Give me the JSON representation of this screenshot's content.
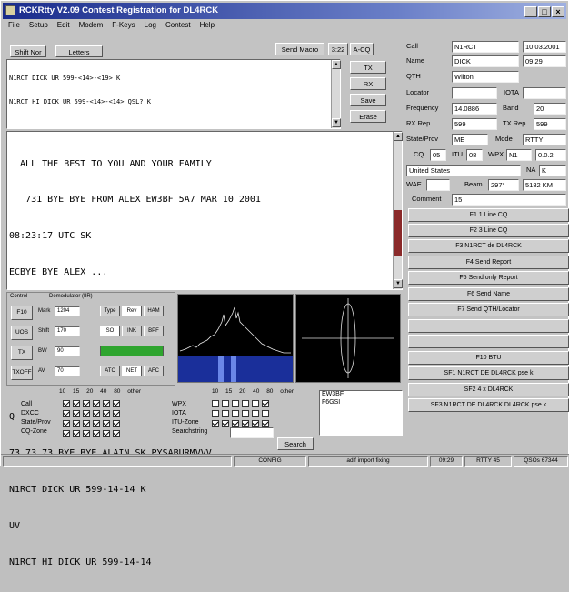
{
  "window": {
    "title": "RCKRtty V2.09 Contest Registration for DL4RCK"
  },
  "menu": [
    "File",
    "Setup",
    "Edit",
    "Modem",
    "F-Keys",
    "Log",
    "Contest",
    "Help"
  ],
  "toolbar": {
    "shift_nor": "Shift Nor",
    "letters": "Letters",
    "send_macro": "Send Macro",
    "time": "3:22",
    "acq": "A-CQ"
  },
  "side_buttons": {
    "tx": "TX",
    "rx": "RX",
    "save": "Save",
    "erase": "Erase"
  },
  "tx_text": [
    "N1RCT DICK UR 599-<14>-<19> K",
    "",
    "N1RCT HI DICK UR 599-<14>-<14> QSL? K"
  ],
  "rx_text": [
    "  ALL THE BEST TO YOU AND YOUR FAMILY",
    "   731 BYE BYE FROM ALEX EW3BF 5A7 MAR 10 2001",
    "08:23:17 UTC SK",
    "ECBYE BYE ALEX ...",
    "",
    "",
    "",
    "Q",
    "73 73 73 BYE BYE ALAIN SK PYSABURMVVV",
    "N1RCT DICK UR 599-14-14 K",
    "UV",
    "N1RCT HI DICK UR 599-14-14"
  ],
  "log": {
    "call_label": "Call",
    "call": "N1RCT",
    "date": "10.03.2001",
    "name_label": "Name",
    "name": "DICK",
    "time": "09:29",
    "qth_label": "QTH",
    "qth": "Wilton",
    "locator_label": "Locator",
    "iota_label": "IOTA",
    "freq_label": "Frequency",
    "freq": "14.0886",
    "band_label": "Band",
    "band": "20",
    "rxrep_label": "RX Rep",
    "rxrep": "599",
    "txrep_label": "TX Rep",
    "txrep": "599",
    "state_label": "State/Prov",
    "state": "ME",
    "mode_label": "Mode",
    "mode": "RTTY",
    "cq_label": "CQ",
    "cq": "05",
    "itu_label": "ITU",
    "itu": "08",
    "wpx_label": "WPX",
    "wpx": "N1",
    "wpx2": "0.0.2",
    "country": "United States",
    "na": "NA",
    "k": "K",
    "wae_label": "WAE",
    "beam_label": "Beam",
    "beam": "297°",
    "dist": "5182 KM",
    "comment_label": "Comment",
    "comment": "15"
  },
  "macros": [
    "F1 1 Line CQ",
    "F2 3 Line CQ",
    "F3 N1RCT de DL4RCK",
    "F4 Send Report",
    "F5 Send only Report",
    "F6 Send Name",
    "F7 Send QTH/Locator",
    "",
    "",
    "F10 BTU",
    "SF1 N1RCT DE DL4RCK pse k",
    "SF2 4 x DL4RCK",
    "SF3 N1RCT DE DL4RCK DL4RCK pse k"
  ],
  "control": {
    "control_label": "Control",
    "demod_label": "Demodulator (IIR)",
    "buttons": [
      "F10",
      "UOS",
      "TX",
      "TXOFF"
    ],
    "mark_label": "Mark",
    "mark": "1204",
    "space_label": "Shift",
    "space": "170",
    "bw_label": "BW",
    "bw": "90",
    "av_label": "AV",
    "av": "70",
    "hz": "Hz",
    "type": "Type",
    "rev": "Rev",
    "hamb": "HAM",
    "opts": [
      "SO",
      "INK",
      "BPF"
    ],
    "atc": "ATC",
    "net": "NET",
    "afc": "AFC"
  },
  "bands": {
    "headers": [
      "10",
      "15",
      "20",
      "40",
      "80",
      "other"
    ],
    "rows_left": [
      "Call",
      "DXCC",
      "State/Prov",
      "CQ-Zone"
    ],
    "rows_right": [
      "WPX",
      "IOTA",
      "ITU-Zone",
      "Searchstring"
    ],
    "search_btn": "Search",
    "calls": [
      "EW3BF",
      "F6GSI"
    ]
  },
  "status": {
    "s1": "CONFIG",
    "s2": "adif import fixing",
    "s3": "09:29",
    "s4": "RTTY 45",
    "s5": "QSOs 67344"
  }
}
